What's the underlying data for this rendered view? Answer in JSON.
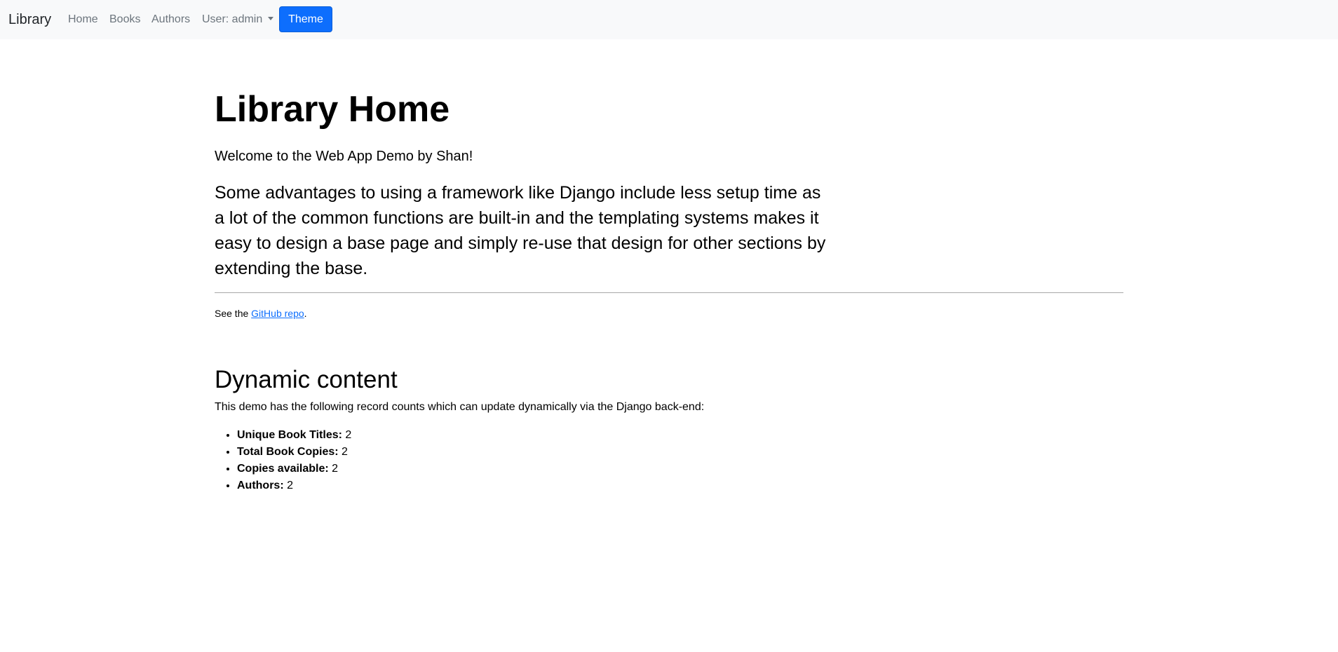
{
  "navbar": {
    "brand": "Library",
    "links": {
      "home": "Home",
      "books": "Books",
      "authors": "Authors",
      "user": "User: admin"
    },
    "theme_button": "Theme"
  },
  "main": {
    "title": "Library Home",
    "welcome": "Welcome to the Web App Demo by Shan!",
    "lead": "Some advantages to using a framework like Django include less setup time as a lot of the common functions are built-in and the templating systems makes it easy to design a base page and simply re-use that design for other sections by extending the base.",
    "repo": {
      "prefix": "See the ",
      "link_text": "GitHub repo",
      "suffix": "."
    },
    "dynamic": {
      "title": "Dynamic content",
      "text": "This demo has the following record counts which can update dynamically via the Django back-end:",
      "stats": [
        {
          "label": "Unique Book Titles:",
          "value": "2"
        },
        {
          "label": "Total Book Copies:",
          "value": "2"
        },
        {
          "label": "Copies available:",
          "value": "2"
        },
        {
          "label": "Authors:",
          "value": "2"
        }
      ]
    }
  },
  "colors": {
    "navbar_bg": "#f8f9fa",
    "primary": "#0d6efd",
    "nav_link": "#6c757d"
  }
}
